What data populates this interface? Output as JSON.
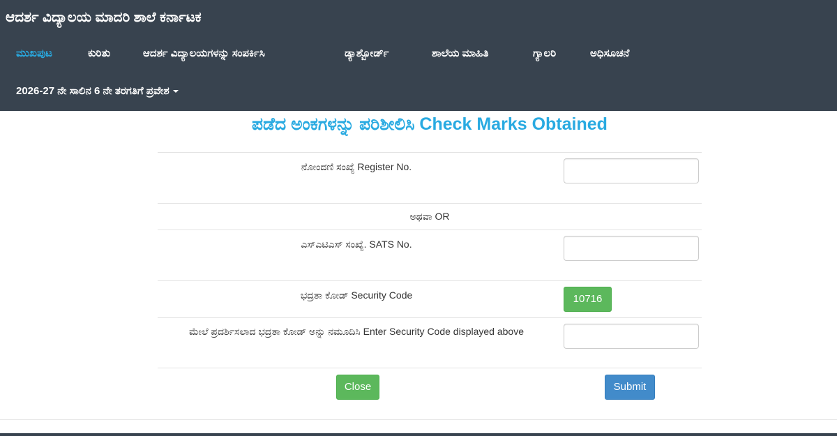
{
  "header": {
    "brand": "ಆದರ್ಶ ವಿದ್ಯಾಲಯ ಮಾದರಿ ಶಾಲೆ ಕರ್ನಾಟಕ",
    "nav": [
      {
        "label": "ಮುಖಪುಟ",
        "active": true
      },
      {
        "label": "ಕುರಿತು"
      },
      {
        "label": "ಆದರ್ಶ ವಿದ್ಯಾಲಯಗಳನ್ನು ಸಂಪರ್ಕಿಸಿ"
      },
      {
        "label": "ಡ್ಯಾಶ್ಬೋರ್ಡ್"
      },
      {
        "label": "ಶಾಲೆಯ ಮಾಹಿತಿ"
      },
      {
        "label": "ಗ್ಯಾಲರಿ"
      },
      {
        "label": "ಅಧಿಸೂಚನೆ"
      }
    ],
    "admission_menu": "2026-27 ನೇ ಸಾಲಿನ 6 ನೇ ತರಗತಿಗೆ ಪ್ರವೇಶ",
    "admission_menu_icon": "caret-down-icon"
  },
  "form": {
    "title": "ಪಡೆದ ಅಂಕಗಳನ್ನು ಪರಿಶೀಲಿಸಿ Check Marks Obtained",
    "register_label": "ನೋಂದಣಿ ಸಂಖ್ಯೆ Register No.",
    "register_value": "",
    "or_text": "ಅಥವಾ OR",
    "sats_label": "ಎಸ್ಎಟಿಎಸ್ ಸಂಖ್ಯೆ. SATS No.",
    "sats_value": "",
    "security_label": "ಭದ್ರತಾ ಕೋಡ್ Security Code",
    "security_code": "10716",
    "enter_code_label": "ಮೇಲೆ ಪ್ರದರ್ಶಿಸಲಾದ ಭದ್ರತಾ ಕೋಡ್ ಅನ್ನು ನಮೂದಿಸಿ Enter Security Code displayed above",
    "enter_code_value": "",
    "close_label": "Close",
    "submit_label": "Submit"
  },
  "colors": {
    "navbar_bg": "#38434f",
    "accent": "#29aae1",
    "success": "#5cb85c",
    "primary": "#428bca"
  }
}
